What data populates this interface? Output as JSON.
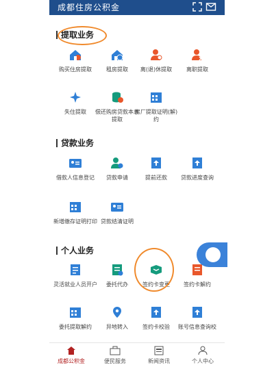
{
  "header": {
    "title": "成都住房公积金"
  },
  "sections": {
    "withdraw": {
      "title": "提取业务",
      "items": [
        "购买住房提取",
        "租房提取",
        "离(退)休提取",
        "离职提取",
        "失住提取",
        "偿还购房贷款本息提取",
        "房厂提取证明(解)约"
      ]
    },
    "loan": {
      "title": "贷款业务",
      "items": [
        "借款人信息登记",
        "贷款申请",
        "提前还款",
        "贷款进度查询",
        "新增缴存证明打印",
        "贷款结清证明"
      ]
    },
    "personal": {
      "title": "个人业务",
      "items": [
        "灵活就业人员开户",
        "委托代办",
        "签约卡变更",
        "签约卡解约",
        "委托提取解约",
        "异地转入",
        "签约卡校验",
        "账号信息查询校"
      ]
    }
  },
  "nav": {
    "items": [
      "成都公积金",
      "便民服务",
      "新闻资讯",
      "个人中心"
    ]
  },
  "colors": {
    "header_bg": "#1f4e8c",
    "accent_blue": "#2f7fd6",
    "accent_orange": "#e9572b",
    "accent_green": "#159b7d",
    "annotation": "#f08a2c"
  }
}
